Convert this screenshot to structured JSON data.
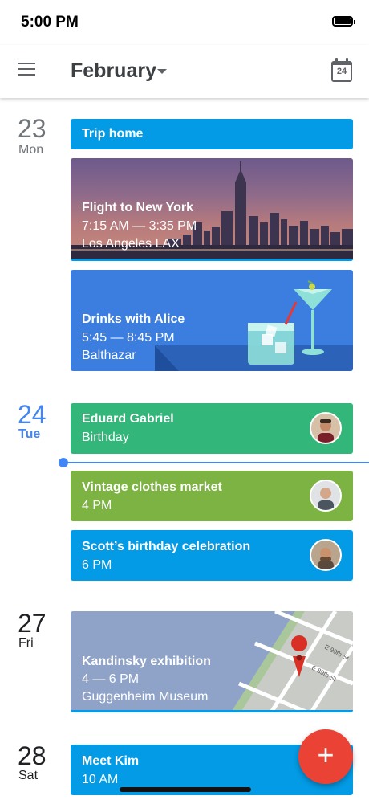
{
  "status_bar": {
    "time": "5:00 PM"
  },
  "header": {
    "month": "February",
    "today_date": "24"
  },
  "days": [
    {
      "number": "23",
      "weekday": "Mon"
    },
    {
      "number": "24",
      "weekday": "Tue"
    },
    {
      "number": "27",
      "weekday": "Fri"
    },
    {
      "number": "28",
      "weekday": "Sat"
    }
  ],
  "events": {
    "trip_home": {
      "title": "Trip home"
    },
    "flight": {
      "title": "Flight to New York",
      "time": "7:15 AM — 3:35 PM",
      "location": "Los Angeles LAX"
    },
    "drinks": {
      "title": "Drinks with Alice",
      "time": "5:45 — 8:45 PM",
      "location": "Balthazar"
    },
    "eduard": {
      "title": "Eduard Gabriel",
      "subtitle": "Birthday"
    },
    "vintage": {
      "title": "Vintage clothes market",
      "time": "4 PM"
    },
    "scott": {
      "title": "Scott’s birthday celebration",
      "time": "6 PM"
    },
    "kandinsky": {
      "title": "Kandinsky exhibition",
      "time": "4 — 6 PM",
      "location": "Guggenheim Museum"
    },
    "meet_kim": {
      "title": "Meet Kim",
      "time": "10 AM"
    }
  },
  "map_labels": {
    "street1": "E 90th St",
    "street2": "E 89th St"
  },
  "colors": {
    "blue_event": "#039be5",
    "green_event": "#33b679",
    "lime_event": "#7cb342",
    "today_accent": "#4285f4",
    "fab": "#ea4335"
  },
  "icons": {
    "menu": "hamburger-menu-icon",
    "dropdown": "caret-down-icon",
    "today": "calendar-today-icon",
    "fab": "plus-icon",
    "map_pin": "map-pin-icon"
  }
}
